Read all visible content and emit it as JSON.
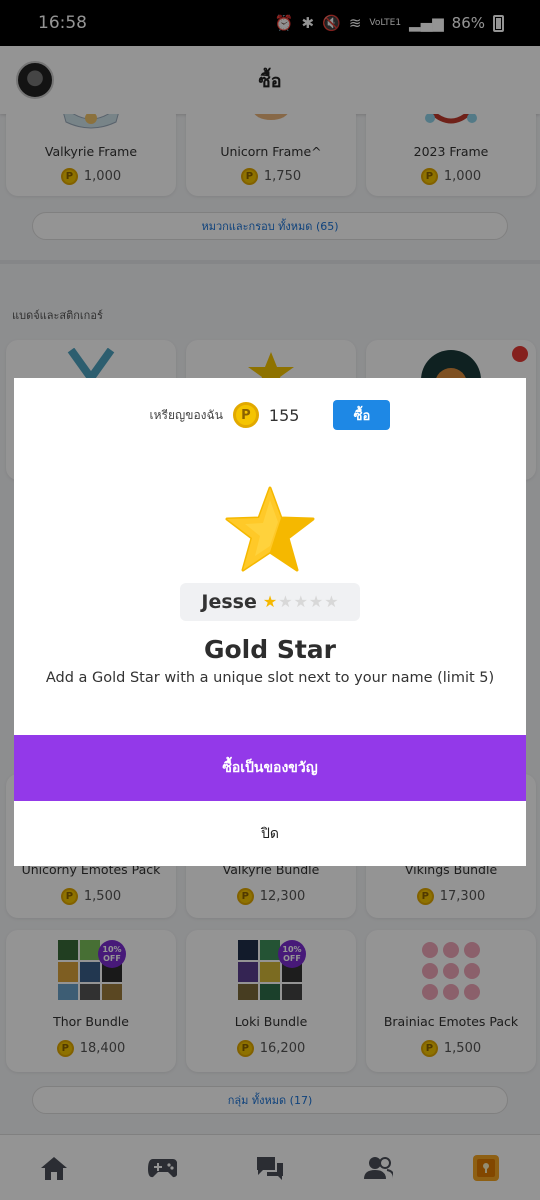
{
  "status_bar": {
    "time": "16:58",
    "battery": "86%",
    "network": "VoLTE1"
  },
  "header": {
    "title": "ซื้อ"
  },
  "frames_row": [
    {
      "name": "Valkyrie Frame",
      "price": "1,000"
    },
    {
      "name": "Unicorn Frame^",
      "price": "1,750"
    },
    {
      "name": "2023 Frame",
      "price": "1,000"
    }
  ],
  "frames_all_label": "หมวกและกรอบ ทั้งหมด (65)",
  "badges_section_label": "แบดจ์และสติกเกอร์",
  "bundles_row1": [
    {
      "name": "Unicorny Emotes Pack",
      "price": "1,500"
    },
    {
      "name": "Valkyrie Bundle",
      "price": "12,300"
    },
    {
      "name": "Vikings Bundle",
      "price": "17,300"
    }
  ],
  "bundles_row2": [
    {
      "name": "Thor Bundle",
      "price": "18,400",
      "badge": "10% OFF"
    },
    {
      "name": "Loki Bundle",
      "price": "16,200",
      "badge": "10% OFF"
    },
    {
      "name": "Brainiac Emotes Pack",
      "price": "1,500"
    }
  ],
  "bundles_all_label": "กลุ่ม ทั้งหมด (17)",
  "coin_symbol": "P",
  "modal": {
    "coins_label": "เหรียญของฉัน",
    "coins_value": "155",
    "buy_label": "ซื้อ",
    "preview_name": "Jesse",
    "preview_stars_filled": 1,
    "preview_stars_total": 5,
    "title": "Gold Star",
    "description": "Add a Gold Star with a unique slot next to your name (limit 5)",
    "gift_label": "ซื้อเป็นของขวัญ",
    "close_label": "ปิด"
  },
  "colors": {
    "gift_button": "#9339e9",
    "buy_button": "#1e88e5",
    "coin": "#f5c400",
    "star": "#f5b800"
  },
  "nav_icons": [
    "home-icon",
    "gamepad-icon",
    "chat-icon",
    "friends-icon",
    "shop-icon"
  ]
}
